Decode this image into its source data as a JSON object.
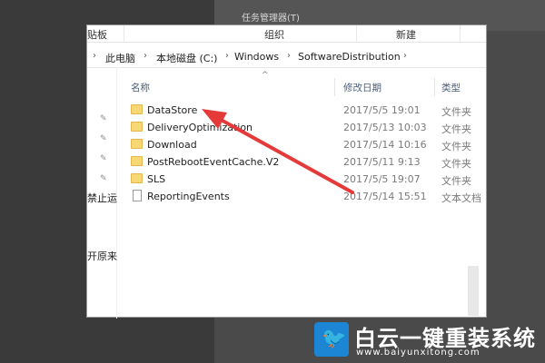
{
  "background": {
    "task_manager_label": "任务管理器(T)"
  },
  "ribbon": {
    "groups": [
      "贴板",
      "组织",
      "新建"
    ]
  },
  "address": {
    "segments": [
      "此电脑",
      "本地磁盘 (C:)",
      "Windows",
      "SoftwareDistribution"
    ]
  },
  "nav": {
    "labels": [
      "禁止运",
      "开原来"
    ]
  },
  "columns": {
    "name": "名称",
    "date": "修改日期",
    "type": "类型"
  },
  "files": [
    {
      "name": "DataStore",
      "date": "2017/5/5 19:01",
      "type": "文件夹",
      "icon": "folder-icon"
    },
    {
      "name": "DeliveryOptimization",
      "date": "2017/5/13 10:03",
      "type": "文件夹",
      "icon": "folder-icon"
    },
    {
      "name": "Download",
      "date": "2017/5/14 10:16",
      "type": "文件夹",
      "icon": "folder-icon"
    },
    {
      "name": "PostRebootEventCache.V2",
      "date": "2017/5/11 9:13",
      "type": "文件夹",
      "icon": "folder-icon"
    },
    {
      "name": "SLS",
      "date": "2017/5/5 19:07",
      "type": "文件夹",
      "icon": "folder-icon"
    },
    {
      "name": "ReportingEvents",
      "date": "2017/5/14 15:51",
      "type": "文本文档",
      "icon": "document-icon"
    }
  ],
  "watermark": {
    "title": "白云一键重装系统",
    "url": "www.baiyunxitong.com"
  },
  "colors": {
    "annotation_arrow": "#e53a3a",
    "folder": "#f8d775",
    "logo_blue": "#1c85d4"
  }
}
